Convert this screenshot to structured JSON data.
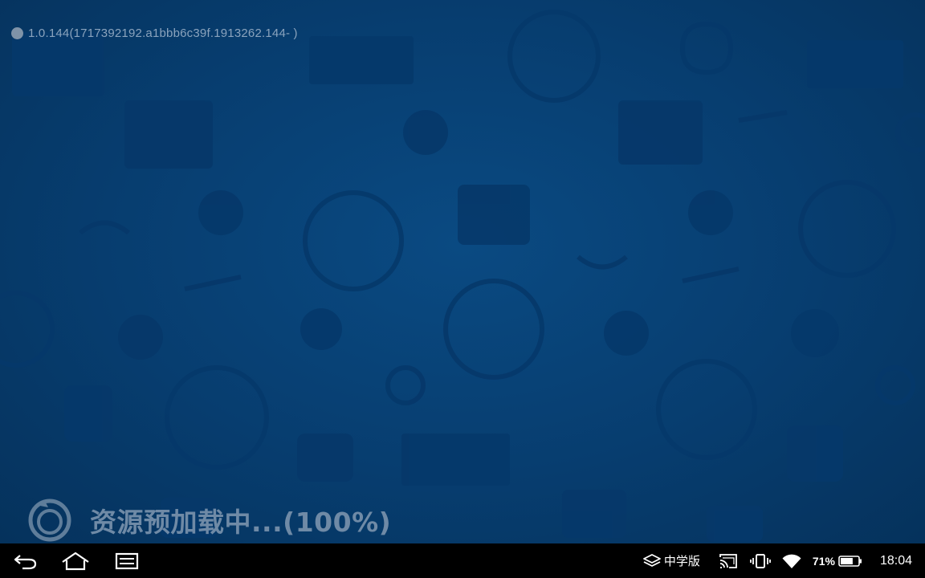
{
  "app": {
    "version_text": "1.0.144(1717392192.a1bbb6c39f.1913262.144- )",
    "loading_text": "资源预加载中...(100%)",
    "loading_progress_percent": 100,
    "background_color": "#073d6f"
  },
  "navbar": {
    "back_icon": "back-arrow-icon",
    "home_icon": "home-icon",
    "recents_icon": "recent-apps-icon"
  },
  "status_bar": {
    "ime_label": "中学版",
    "ime_icon": "layers-icon",
    "cast_icon": "cast-icon",
    "vibrate_icon": "vibrate-icon",
    "wifi_icon": "wifi-icon",
    "battery_percent_text": "71%",
    "battery_level": 0.71,
    "time": "18:04"
  }
}
